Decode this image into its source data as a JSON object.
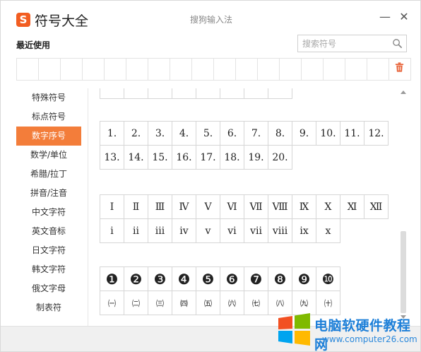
{
  "window": {
    "logo_letter": "S",
    "title": "符号大全",
    "subtitle": "搜狗输入法",
    "minimize": "—",
    "close": "✕"
  },
  "recent": {
    "label": "最近使用",
    "cell_count": 18
  },
  "search": {
    "placeholder": "搜索符号"
  },
  "sidebar": {
    "items": [
      {
        "label": "特殊符号"
      },
      {
        "label": "标点符号"
      },
      {
        "label": "数字序号",
        "active": true
      },
      {
        "label": "数学/单位"
      },
      {
        "label": "希腊/拉丁"
      },
      {
        "label": "拼音/注音"
      },
      {
        "label": "中文字符"
      },
      {
        "label": "英文音标"
      },
      {
        "label": "日文字符"
      },
      {
        "label": "韩文字符"
      },
      {
        "label": "俄文字母"
      },
      {
        "label": "制表符"
      }
    ]
  },
  "content": {
    "arabic_rows": [
      [
        "1.",
        "2.",
        "3.",
        "4.",
        "5.",
        "6.",
        "7.",
        "8.",
        "9.",
        "10.",
        "11.",
        "12."
      ],
      [
        "13.",
        "14.",
        "15.",
        "16.",
        "17.",
        "18.",
        "19.",
        "20."
      ]
    ],
    "roman_rows": [
      [
        "Ⅰ",
        "Ⅱ",
        "Ⅲ",
        "Ⅳ",
        "Ⅴ",
        "Ⅵ",
        "Ⅶ",
        "Ⅷ",
        "Ⅸ",
        "Ⅹ",
        "Ⅺ",
        "Ⅻ"
      ],
      [
        "ⅰ",
        "ⅱ",
        "ⅲ",
        "ⅳ",
        "ⅴ",
        "ⅵ",
        "ⅶ",
        "ⅷ",
        "ⅸ",
        "ⅹ"
      ]
    ],
    "circled_rows": [
      [
        "❶",
        "❷",
        "❸",
        "❹",
        "❺",
        "❻",
        "❼",
        "❽",
        "❾",
        "❿"
      ],
      [
        "㈠",
        "㈡",
        "㈢",
        "㈣",
        "㈤",
        "㈥",
        "㈦",
        "㈧",
        "㈨",
        "㈩"
      ]
    ]
  },
  "watermark": {
    "text": "电脑软硬件教程网",
    "url": "www.computer26.com"
  },
  "colors": {
    "accent": "#f37d3a",
    "logo": "#f25d21",
    "watermark": "#1d7fd8"
  },
  "icons": {
    "search": "search-icon",
    "trash": "trash-icon",
    "close": "close-icon",
    "minimize": "minimize-icon"
  }
}
